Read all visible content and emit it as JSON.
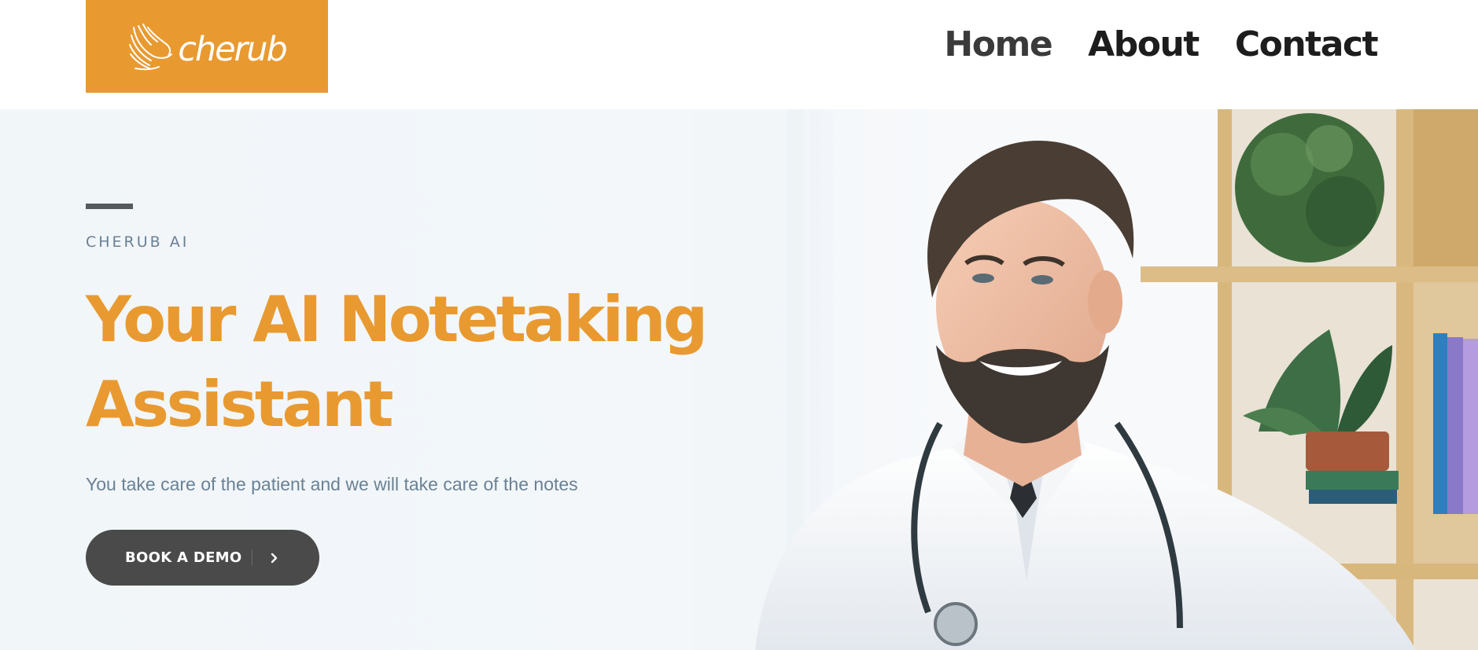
{
  "header": {
    "logo_text": "cherub",
    "logo_icon": "wings-icon",
    "nav": [
      {
        "label": "Home"
      },
      {
        "label": "About"
      },
      {
        "label": "Contact"
      }
    ]
  },
  "hero": {
    "eyebrow": "CHERUB AI",
    "headline_line1": "Your AI Notetaking",
    "headline_line2": "Assistant",
    "subtext": "You take care of the patient and we will take care of the notes",
    "cta_label": "BOOK A DEMO",
    "cta_icon": "chevron-right-icon",
    "image_subject": "doctor-photo"
  },
  "colors": {
    "brand_orange": "#e89a31",
    "button_dark": "#4a4a4a",
    "nav_text": "#1d1d1d",
    "muted_text": "#6b8194",
    "accent_line": "#555a5e"
  }
}
